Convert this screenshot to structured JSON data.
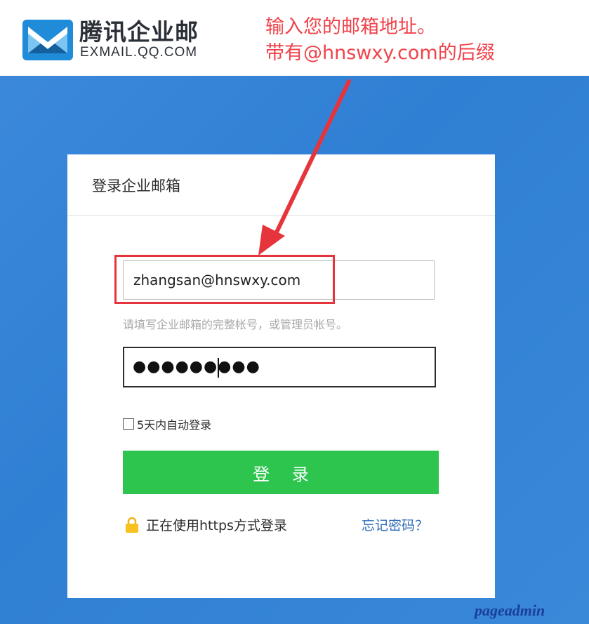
{
  "header": {
    "logo_cn": "腾讯企业邮",
    "logo_en": "EXMAIL.QQ.COM"
  },
  "annotation": {
    "line1": "输入您的邮箱地址。",
    "line2": "带有@hnswxy.com的后缀",
    "color": "#f0424a"
  },
  "login": {
    "title": "登录企业邮箱",
    "email_value": "zhangsan@hnswxy.com",
    "email_hint": "请填写企业邮箱的完整帐号，或管理员帐号。",
    "password_mask": "●●●●●●●●●",
    "remember_label": "5天内自动登录",
    "submit_label": "登 录",
    "https_note": "正在使用https方式登录",
    "forgot_label": "忘记密码？",
    "button_color": "#2dc54e"
  },
  "watermark": "pageadmin",
  "icons": {
    "logo": "exmail-logo-icon",
    "lock": "lock-icon",
    "checkbox": "checkbox-icon",
    "arrow": "red-arrow"
  }
}
